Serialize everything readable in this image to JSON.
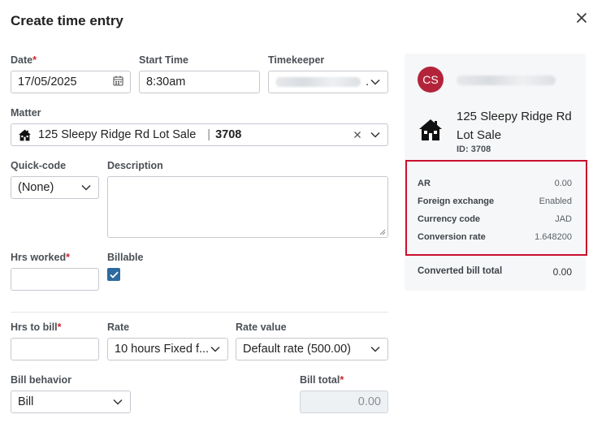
{
  "dialog": {
    "title": "Create time entry"
  },
  "fields": {
    "date": {
      "label": "Date",
      "value": "17/05/2025"
    },
    "start_time": {
      "label": "Start Time",
      "value": "8:30am"
    },
    "timekeeper": {
      "label": "Timekeeper",
      "value_suffix": "."
    },
    "matter": {
      "label": "Matter",
      "name": "125 Sleepy Ridge Rd Lot Sale",
      "separator": "|",
      "id": "3708"
    },
    "quick_code": {
      "label": "Quick-code",
      "value": "(None)"
    },
    "description": {
      "label": "Description",
      "value": ""
    },
    "hrs_worked": {
      "label": "Hrs worked",
      "value": ""
    },
    "billable": {
      "label": "Billable",
      "checked": true
    },
    "hrs_to_bill": {
      "label": "Hrs to bill",
      "value": ""
    },
    "rate": {
      "label": "Rate",
      "value": "10 hours Fixed f..."
    },
    "rate_value": {
      "label": "Rate value",
      "value": "Default rate (500.00)"
    },
    "bill_behavior": {
      "label": "Bill behavior",
      "value": "Bill"
    },
    "bill_total": {
      "label": "Bill total",
      "value": "0.00"
    }
  },
  "required_mark": "*",
  "panel": {
    "avatar_initials": "CS",
    "matter_name": "125 Sleepy Ridge Rd Lot Sale",
    "matter_id": "ID: 3708",
    "rows": [
      {
        "key": "AR",
        "value": "0.00"
      },
      {
        "key": "Foreign exchange",
        "value": "Enabled"
      },
      {
        "key": "Currency code",
        "value": "JAD"
      },
      {
        "key": "Conversion rate",
        "value": "1.648200"
      }
    ],
    "total": {
      "key": "Converted bill total",
      "value": "0.00"
    }
  },
  "colors": {
    "accent": "#2d6a9f",
    "required": "#d0252f",
    "highlight_border": "#c8102e",
    "avatar": "#b3243b"
  },
  "icons": [
    "close-icon",
    "calendar-icon",
    "chevron-down-icon",
    "house-icon",
    "clear-icon",
    "checkmark-icon",
    "resize-grip-icon"
  ]
}
